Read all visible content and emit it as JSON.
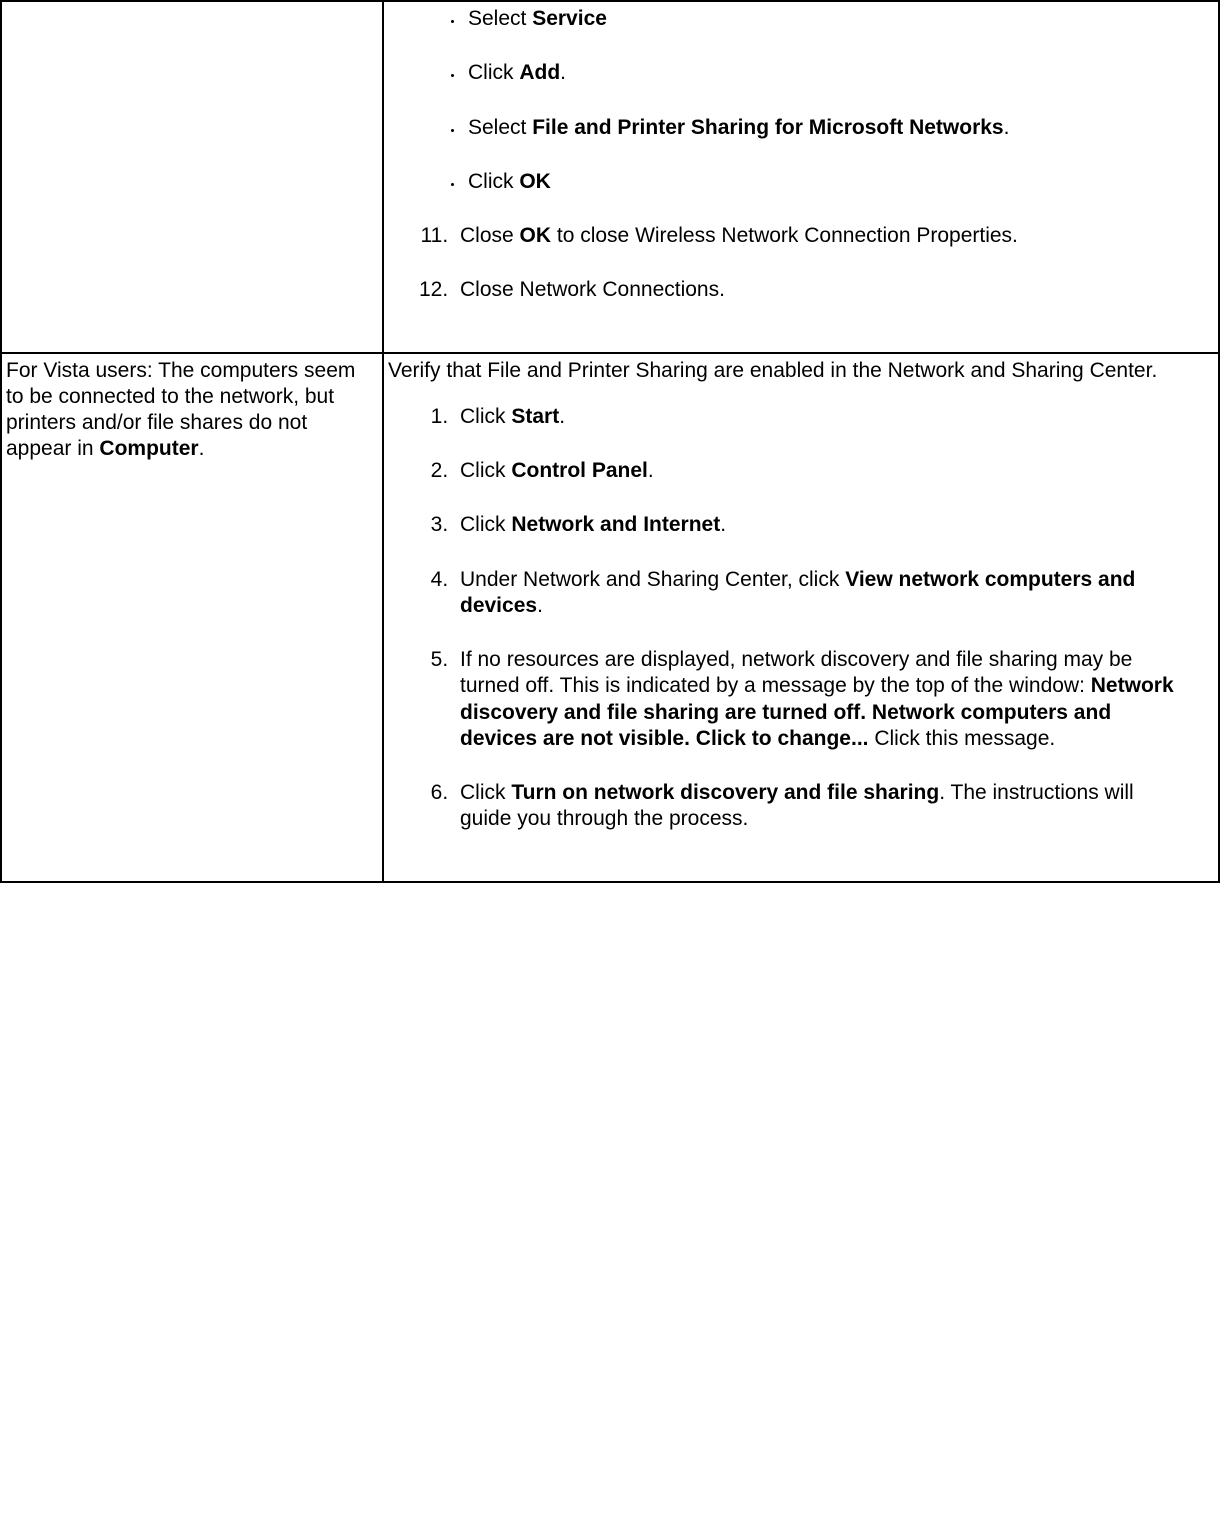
{
  "row1": {
    "bullets": [
      {
        "pre": "Select ",
        "bold": "Service",
        "post": ""
      },
      {
        "pre": "Click ",
        "bold": "Add",
        "post": "."
      },
      {
        "pre": "Select ",
        "bold": "File and Printer Sharing for Microsoft Networks",
        "post": "."
      },
      {
        "pre": "Click ",
        "bold": "OK",
        "post": ""
      }
    ],
    "step11": {
      "pre": "Close ",
      "bold": "OK",
      "post": " to close Wireless Network Connection Properties."
    },
    "step12": "Close Network Connections."
  },
  "row2": {
    "left": {
      "pre": "For Vista users: The computers seem to be connected to the network, but printers and/or file shares do not appear in ",
      "bold": "Computer",
      "post": "."
    },
    "intro": "Verify that File and Printer Sharing are enabled in the Network and Sharing Center.",
    "steps": [
      {
        "pre": "Click ",
        "bold": "Start",
        "post": "."
      },
      {
        "pre": "Click ",
        "bold": "Control Panel",
        "post": "."
      },
      {
        "pre": "Click ",
        "bold": "Network and Internet",
        "post": "."
      },
      {
        "pre": "Under Network and Sharing Center, click ",
        "bold": "View network computers and devices",
        "post": "."
      },
      {
        "pre": "If no resources are displayed, network discovery and file sharing may be turned off. This is indicated by a message by the top of the window: ",
        "bold": "Network discovery and file sharing are turned off. Network computers and devices are not visible. Click to change...",
        "post": " Click this message."
      },
      {
        "pre": "Click ",
        "bold": "Turn on network discovery and file sharing",
        "post": ". The instructions will guide you through the process."
      }
    ]
  }
}
